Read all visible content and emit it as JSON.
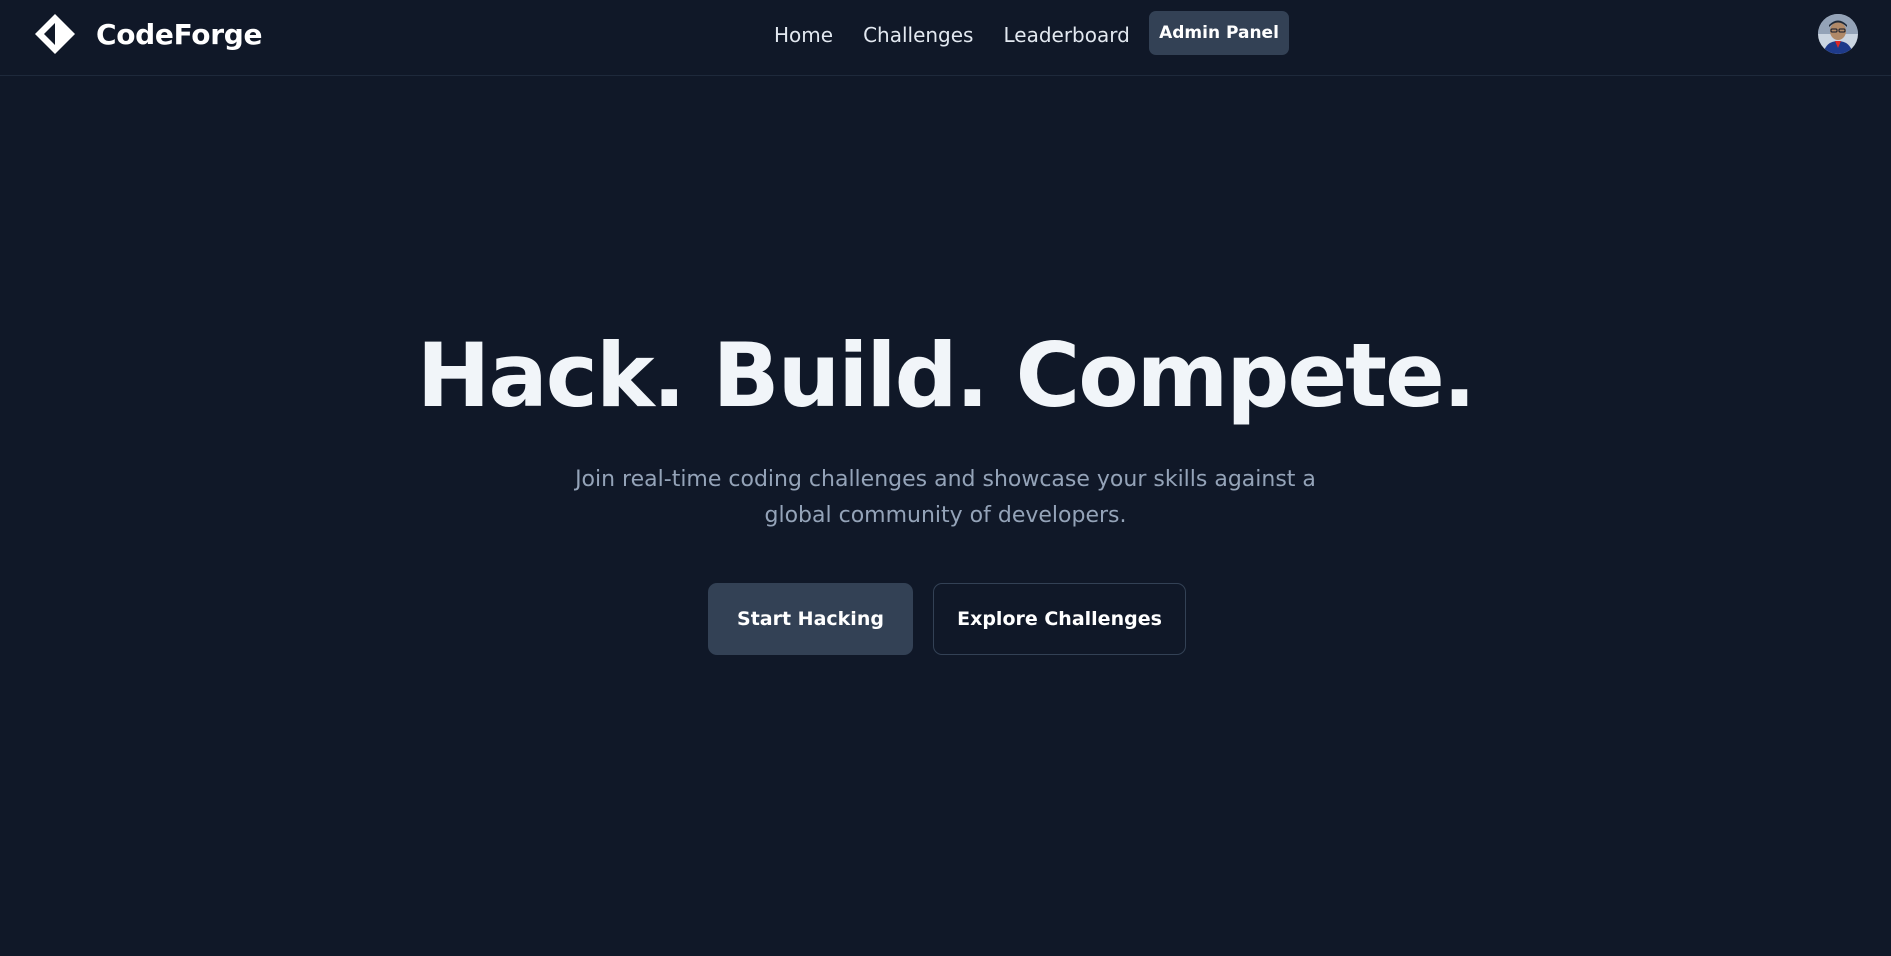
{
  "brand": {
    "name": "CodeForge",
    "logo_icon": "diamond-logo-icon"
  },
  "nav": {
    "links": [
      {
        "label": "Home"
      },
      {
        "label": "Challenges"
      },
      {
        "label": "Leaderboard"
      }
    ],
    "admin_label": "Admin Panel"
  },
  "user": {
    "avatar_icon": "user-avatar"
  },
  "hero": {
    "title": "Hack. Build. Compete.",
    "subtitle": "Join real-time coding challenges and showcase your skills against a global community of developers.",
    "primary_cta": "Start Hacking",
    "secondary_cta": "Explore Challenges"
  },
  "colors": {
    "background": "#101828",
    "button_fill": "#334155",
    "muted_text": "#94a3b8",
    "heading_text": "#f1f5f9"
  }
}
